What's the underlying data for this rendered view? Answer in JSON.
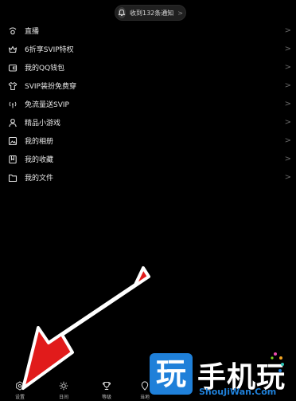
{
  "notification_pill": {
    "text": "收到132条通知",
    "chevron": ">",
    "icon": "bell-icon"
  },
  "menu": {
    "chevron": ">",
    "items": [
      {
        "label": "直播",
        "icon": "live-icon"
      },
      {
        "label": "6折享SVIP特权",
        "icon": "crown-icon"
      },
      {
        "label": "我的QQ钱包",
        "icon": "wallet-icon"
      },
      {
        "label": "SVIP装扮免费穿",
        "icon": "shirt-icon"
      },
      {
        "label": "免流量送SVIP",
        "icon": "signal-icon"
      },
      {
        "label": "精品小游戏",
        "icon": "game-icon"
      },
      {
        "label": "我的相册",
        "icon": "photo-icon"
      },
      {
        "label": "我的收藏",
        "icon": "bookmark-icon"
      },
      {
        "label": "我的文件",
        "icon": "folder-icon"
      }
    ]
  },
  "bottom_bar": {
    "tabs": [
      {
        "label": "设置",
        "icon": "settings-icon"
      },
      {
        "label": "日间",
        "icon": "sun-icon"
      },
      {
        "label": "等级",
        "icon": "level-icon"
      },
      {
        "label": "当地",
        "icon": "location-icon"
      }
    ]
  },
  "watermark": {
    "glyph": "玩",
    "title": "手机玩",
    "url": "ShouJiWan.Com"
  },
  "colors": {
    "background": "#000000",
    "arrow_red": "#e11b1b",
    "watermark_blue": "#1f80d9",
    "badge_red": "#ff3b3b"
  }
}
